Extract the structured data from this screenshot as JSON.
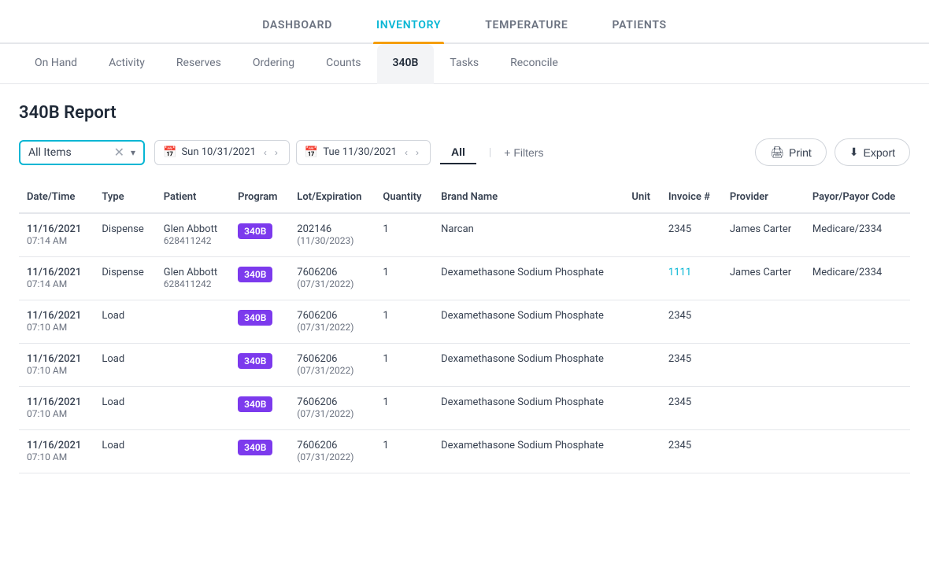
{
  "topNav": {
    "items": [
      {
        "id": "dashboard",
        "label": "DASHBOARD",
        "active": false
      },
      {
        "id": "inventory",
        "label": "INVENTORY",
        "active": true
      },
      {
        "id": "temperature",
        "label": "TEMPERATURE",
        "active": false
      },
      {
        "id": "patients",
        "label": "PATIENTS",
        "active": false
      }
    ]
  },
  "subNav": {
    "items": [
      {
        "id": "on-hand",
        "label": "On Hand",
        "active": false
      },
      {
        "id": "activity",
        "label": "Activity",
        "active": false
      },
      {
        "id": "reserves",
        "label": "Reserves",
        "active": false
      },
      {
        "id": "ordering",
        "label": "Ordering",
        "active": false
      },
      {
        "id": "counts",
        "label": "Counts",
        "active": false
      },
      {
        "id": "340b",
        "label": "340B",
        "active": true
      },
      {
        "id": "tasks",
        "label": "Tasks",
        "active": false
      },
      {
        "id": "reconcile",
        "label": "Reconcile",
        "active": false
      }
    ]
  },
  "pageTitle": "340B Report",
  "filters": {
    "dropdown": {
      "value": "All Items",
      "placeholder": "All Items"
    },
    "startDate": "Sun 10/31/2021",
    "endDate": "Tue 11/30/2021",
    "allLabel": "All",
    "plusFilters": "+ Filters"
  },
  "actions": {
    "print": "Print",
    "export": "Export"
  },
  "table": {
    "columns": [
      "Date/Time",
      "Type",
      "Patient",
      "Program",
      "Lot/Expiration",
      "Quantity",
      "Brand Name",
      "Unit",
      "Invoice #",
      "Provider",
      "Payor/Payor Code"
    ],
    "rows": [
      {
        "date": "11/16/2021",
        "time": "07:14 AM",
        "type": "Dispense",
        "patient": "Glen Abbott",
        "patientId": "628411242",
        "program": "340B",
        "lot": "202146",
        "expiration": "11/30/2023",
        "quantity": "1",
        "brandName": "Narcan",
        "unit": "",
        "invoice": "2345",
        "invoiceLink": false,
        "provider": "James Carter",
        "payor": "Medicare/2334"
      },
      {
        "date": "11/16/2021",
        "time": "07:14 AM",
        "type": "Dispense",
        "patient": "Glen Abbott",
        "patientId": "628411242",
        "program": "340B",
        "lot": "7606206",
        "expiration": "07/31/2022",
        "quantity": "1",
        "brandName": "Dexamethasone Sodium Phosphate",
        "unit": "",
        "invoice": "1111",
        "invoiceLink": true,
        "provider": "James Carter",
        "payor": "Medicare/2334"
      },
      {
        "date": "11/16/2021",
        "time": "07:10 AM",
        "type": "Load",
        "patient": "",
        "patientId": "",
        "program": "340B",
        "lot": "7606206",
        "expiration": "07/31/2022",
        "quantity": "1",
        "brandName": "Dexamethasone Sodium Phosphate",
        "unit": "",
        "invoice": "2345",
        "invoiceLink": false,
        "provider": "",
        "payor": ""
      },
      {
        "date": "11/16/2021",
        "time": "07:10 AM",
        "type": "Load",
        "patient": "",
        "patientId": "",
        "program": "340B",
        "lot": "7606206",
        "expiration": "07/31/2022",
        "quantity": "1",
        "brandName": "Dexamethasone Sodium Phosphate",
        "unit": "",
        "invoice": "2345",
        "invoiceLink": false,
        "provider": "",
        "payor": ""
      },
      {
        "date": "11/16/2021",
        "time": "07:10 AM",
        "type": "Load",
        "patient": "",
        "patientId": "",
        "program": "340B",
        "lot": "7606206",
        "expiration": "07/31/2022",
        "quantity": "1",
        "brandName": "Dexamethasone Sodium Phosphate",
        "unit": "",
        "invoice": "2345",
        "invoiceLink": false,
        "provider": "",
        "payor": ""
      },
      {
        "date": "11/16/2021",
        "time": "07:10 AM",
        "type": "Load",
        "patient": "",
        "patientId": "",
        "program": "340B",
        "lot": "7606206",
        "expiration": "07/31/2022",
        "quantity": "1",
        "brandName": "Dexamethasone Sodium Phosphate",
        "unit": "",
        "invoice": "2345",
        "invoiceLink": false,
        "provider": "",
        "payor": ""
      }
    ]
  }
}
